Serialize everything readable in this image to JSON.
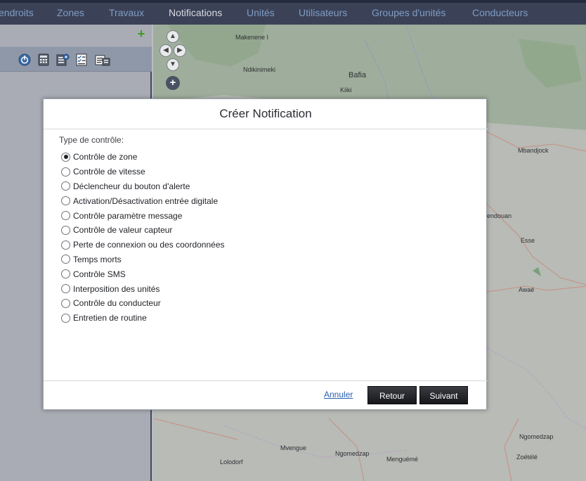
{
  "nav": {
    "items": [
      {
        "label": "endroits",
        "active": false
      },
      {
        "label": "Zones",
        "active": false
      },
      {
        "label": "Travaux",
        "active": false
      },
      {
        "label": "Notifications",
        "active": true
      },
      {
        "label": "Unités",
        "active": false
      },
      {
        "label": "Utilisateurs",
        "active": false
      },
      {
        "label": "Groupes d'unités",
        "active": false
      },
      {
        "label": "Conducteurs",
        "active": false
      }
    ]
  },
  "left_panel": {
    "add_icon": "plus-icon",
    "tools": [
      "power-icon",
      "calculator-icon",
      "settings-list-icon",
      "checklist-icon",
      "report-icon"
    ]
  },
  "map": {
    "labels": [
      {
        "text": "Makenene I"
      },
      {
        "text": "Ndikinimeki"
      },
      {
        "text": "Bafia"
      },
      {
        "text": "Kiiki"
      },
      {
        "text": "Mbandjock"
      },
      {
        "text": "endouan"
      },
      {
        "text": "Esse"
      },
      {
        "text": "Awaé"
      },
      {
        "text": "Mvengue"
      },
      {
        "text": "Ngomedzap"
      },
      {
        "text": "Lolodorf"
      },
      {
        "text": "Menguémé"
      },
      {
        "text": "Ngomedzap"
      },
      {
        "text": "Zoétélé"
      }
    ]
  },
  "modal": {
    "title": "Créer Notification",
    "section_label": "Type de contrôle:",
    "options": [
      {
        "label": "Contrôle de zone",
        "checked": true
      },
      {
        "label": "Contrôle de vitesse",
        "checked": false
      },
      {
        "label": "Déclencheur du bouton d'alerte",
        "checked": false
      },
      {
        "label": "Activation/Désactivation entrée digitale",
        "checked": false
      },
      {
        "label": "Contrôle paramètre message",
        "checked": false
      },
      {
        "label": "Contrôle de valeur capteur",
        "checked": false
      },
      {
        "label": "Perte de connexion ou des coordonnées",
        "checked": false
      },
      {
        "label": "Temps morts",
        "checked": false
      },
      {
        "label": "Contrôle SMS",
        "checked": false
      },
      {
        "label": "Interposition des unités",
        "checked": false
      },
      {
        "label": "Contrôle du conducteur",
        "checked": false
      },
      {
        "label": "Entretien de routine",
        "checked": false
      }
    ],
    "cancel_label": "Annuler",
    "back_label": "Retour",
    "next_label": "Suivant"
  }
}
